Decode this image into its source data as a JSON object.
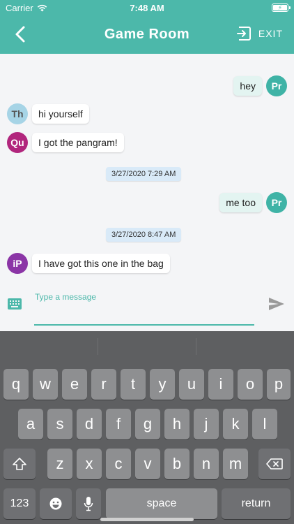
{
  "status_bar": {
    "carrier": "Carrier",
    "time": "7:48 AM"
  },
  "nav": {
    "title": "Game Room",
    "exit_label": "EXIT"
  },
  "messages": [
    {
      "avatar": "Pr",
      "text": "hey",
      "avatar_color": "#3fb3a6"
    },
    {
      "avatar": "Th",
      "text": "hi yourself",
      "avatar_color": "#a6d4e6",
      "avatar_text_color": "#555555"
    },
    {
      "avatar": "Qu",
      "text": "I got the pangram!",
      "avatar_color": "#b1267d"
    },
    {
      "avatar": "Pr",
      "text": "me too",
      "avatar_color": "#3fb3a6"
    },
    {
      "avatar": "iP",
      "text": "I have got this one in the bag",
      "avatar_color": "#8b35a6"
    }
  ],
  "timestamps": [
    "3/27/2020 7:29 AM",
    "3/27/2020 8:47 AM"
  ],
  "input": {
    "placeholder": "Type a message"
  },
  "keyboard": {
    "row1": [
      "q",
      "w",
      "e",
      "r",
      "t",
      "y",
      "u",
      "i",
      "o",
      "p"
    ],
    "row2": [
      "a",
      "s",
      "d",
      "f",
      "g",
      "h",
      "j",
      "k",
      "l"
    ],
    "row3": [
      "z",
      "x",
      "c",
      "v",
      "b",
      "n",
      "m"
    ],
    "numbers_label": "123",
    "space_label": "space",
    "return_label": "return"
  },
  "colors": {
    "accent": "#4cb8aa",
    "keyboard_bg": "#5e5f61",
    "key_bg": "#8e8f91"
  }
}
